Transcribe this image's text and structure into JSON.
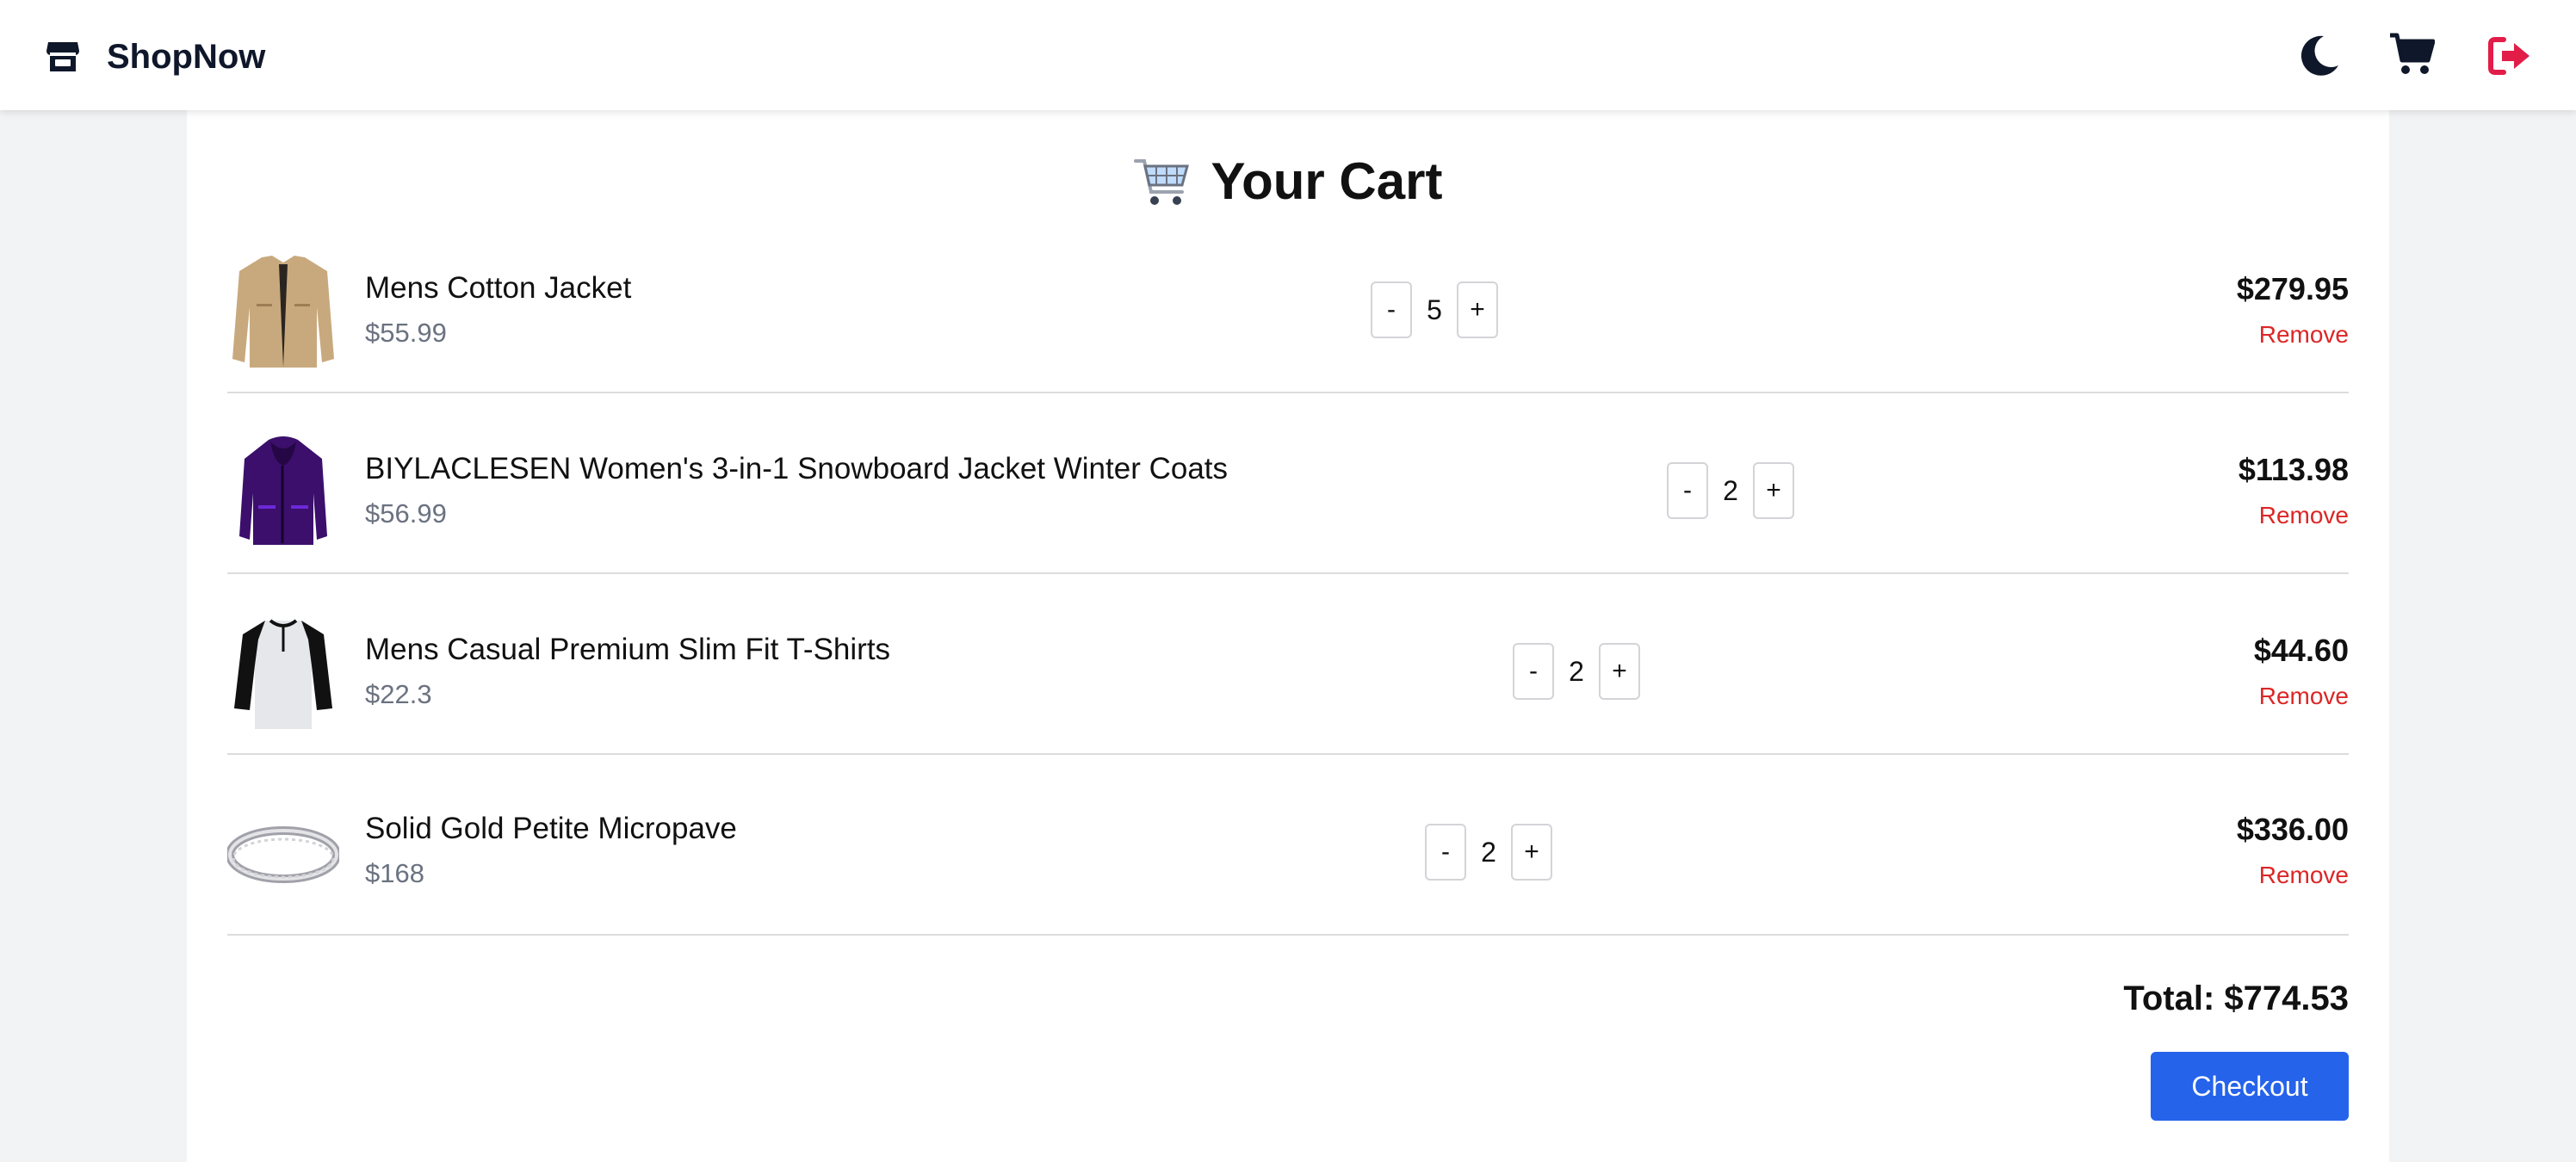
{
  "header": {
    "brand_name": "ShopNow",
    "icons": [
      "store-icon",
      "moon-icon",
      "cart-icon",
      "logout-icon"
    ],
    "logout_color": "#e11d48"
  },
  "cart": {
    "title": "Your Cart",
    "items": [
      {
        "name": "Mens Cotton Jacket",
        "unit_price": "$55.99",
        "qty": "5",
        "subtotal": "$279.95",
        "remove_label": "Remove",
        "minus_label": "-",
        "plus_label": "+"
      },
      {
        "name": "BIYLACLESEN Women's 3-in-1 Snowboard Jacket Winter Coats",
        "unit_price": "$56.99",
        "qty": "2",
        "subtotal": "$113.98",
        "remove_label": "Remove",
        "minus_label": "-",
        "plus_label": "+"
      },
      {
        "name": "Mens Casual Premium Slim Fit T-Shirts",
        "unit_price": "$22.3",
        "qty": "2",
        "subtotal": "$44.60",
        "remove_label": "Remove",
        "minus_label": "-",
        "plus_label": "+"
      },
      {
        "name": "Solid Gold Petite Micropave",
        "unit_price": "$168",
        "qty": "2",
        "subtotal": "$336.00",
        "remove_label": "Remove",
        "minus_label": "-",
        "plus_label": "+"
      }
    ],
    "total_label": "Total: $774.53",
    "checkout_label": "Checkout"
  },
  "colors": {
    "accent": "#2563eb",
    "remove": "#dc2626",
    "muted": "#6b7280"
  }
}
